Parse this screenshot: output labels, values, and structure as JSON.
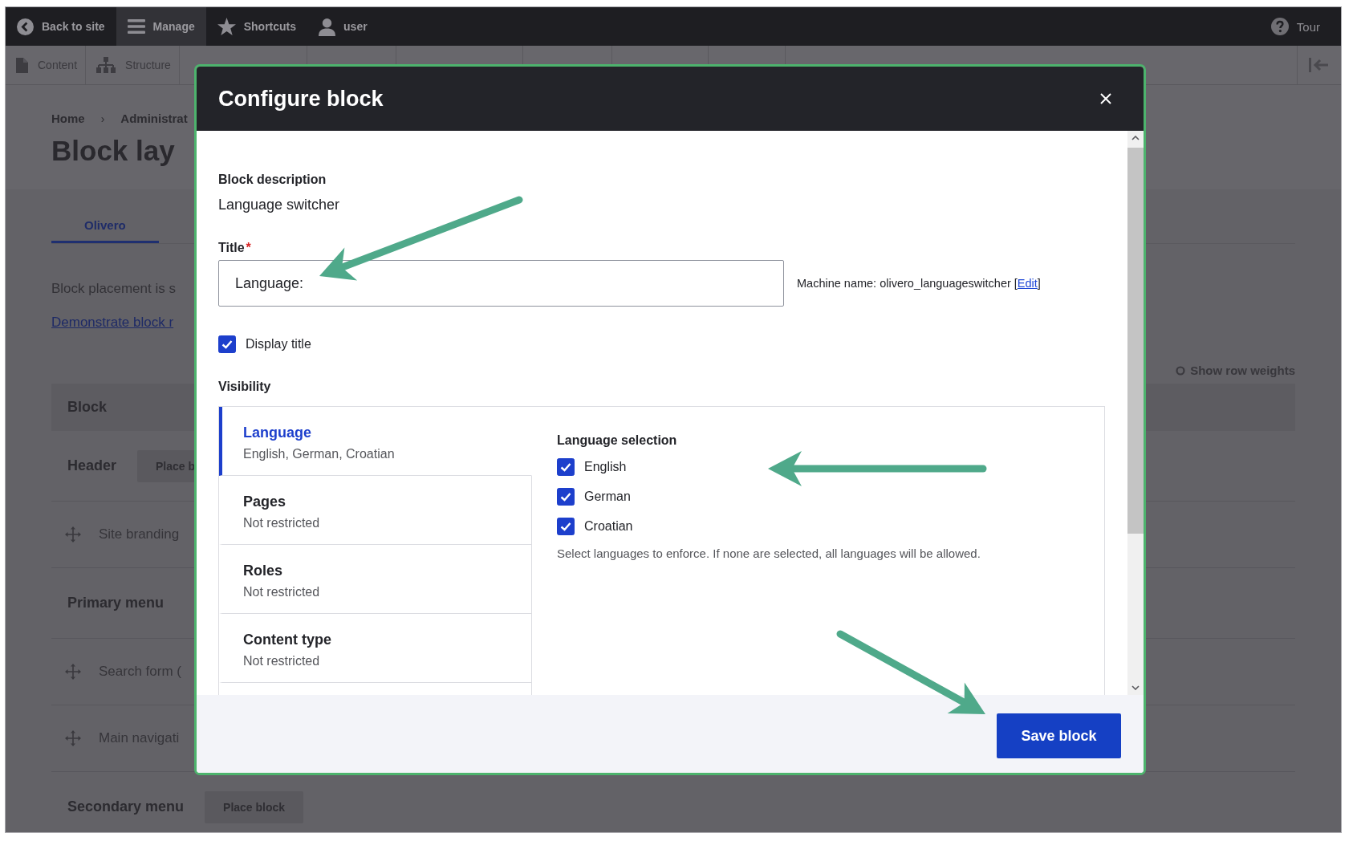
{
  "toolbar": {
    "items": [
      {
        "kind": "back",
        "label": "Back to site",
        "selected": false
      },
      {
        "kind": "menu",
        "label": "Manage",
        "selected": true
      },
      {
        "kind": "star",
        "label": "Shortcuts",
        "selected": false
      },
      {
        "kind": "user",
        "label": "user",
        "selected": false
      }
    ],
    "tour": "Tour"
  },
  "tray": {
    "items": [
      {
        "kind": "content",
        "label": "Content"
      },
      {
        "kind": "structure",
        "label": "Structure"
      }
    ]
  },
  "page": {
    "breadcrumb": {
      "items": [
        "Home",
        "Administrat"
      ],
      "separator": "›"
    },
    "title": "Block lay",
    "tabs": [
      {
        "label": "Olivero",
        "selected": true
      }
    ],
    "intro": "Block placement is s",
    "demo_link": "Demonstrate block r",
    "show_row_weights": "Show row weights",
    "table": {
      "header": "Block",
      "rows": [
        {
          "kind": "region",
          "label": "Header",
          "button": "Place b"
        },
        {
          "kind": "block",
          "label": "Site branding"
        },
        {
          "kind": "region",
          "label": "Primary menu"
        },
        {
          "kind": "block",
          "label": "Search form ("
        },
        {
          "kind": "block",
          "label": "Main navigati"
        },
        {
          "kind": "region",
          "label": "Secondary menu",
          "button": "Place block"
        }
      ]
    }
  },
  "dialog": {
    "title": "Configure block",
    "description_label": "Block description",
    "description": "Language switcher",
    "title_field": {
      "label": "Title",
      "required_mark": "*",
      "value": "Language:"
    },
    "machine_name": {
      "text": "Machine name: olivero_languageswitcher [",
      "link": "Edit",
      "after": "]"
    },
    "display_title": {
      "label": "Display title",
      "checked": true
    },
    "visibility_label": "Visibility",
    "visibility_tabs": [
      {
        "title": "Language",
        "summary": "English, German, Croatian",
        "selected": true
      },
      {
        "title": "Pages",
        "summary": "Not restricted",
        "selected": false
      },
      {
        "title": "Roles",
        "summary": "Not restricted",
        "selected": false
      },
      {
        "title": "Content type",
        "summary": "Not restricted",
        "selected": false
      }
    ],
    "language_pane": {
      "label": "Language selection",
      "options": [
        {
          "label": "English",
          "checked": true
        },
        {
          "label": "German",
          "checked": true
        },
        {
          "label": "Croatian",
          "checked": true
        }
      ],
      "description": "Select languages to enforce. If none are selected, all languages will be allowed."
    },
    "save_button": "Save block"
  }
}
